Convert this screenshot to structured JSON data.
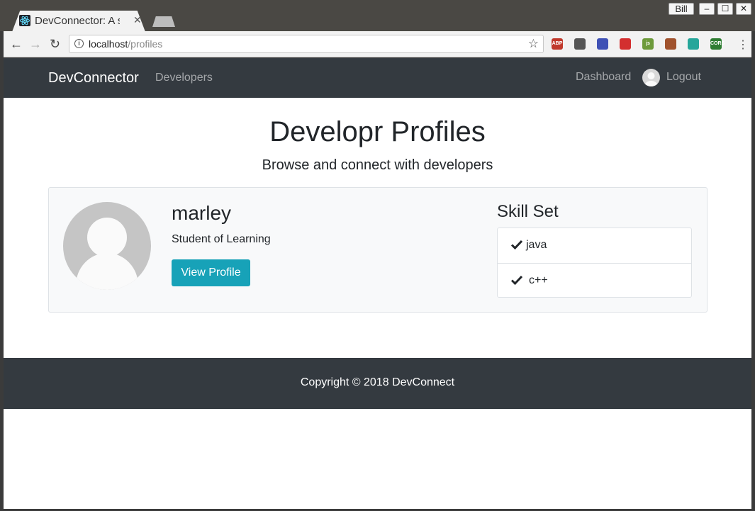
{
  "browser": {
    "tab_title": "DevConnector: A so",
    "url_host": "localhost",
    "url_path": "/profiles",
    "profile_name": "Bill",
    "extensions": [
      {
        "name": "adblock-plus-icon",
        "label": "ABP",
        "color": "#c0392b"
      },
      {
        "name": "sync-icon",
        "label": "",
        "color": "#555555"
      },
      {
        "name": "color-picker-icon",
        "label": "",
        "color": "#3f51b5"
      },
      {
        "name": "extension-red-icon",
        "label": "",
        "color": "#d32f2f"
      },
      {
        "name": "javascript-icon",
        "label": "js",
        "color": "#6d9a3b"
      },
      {
        "name": "monkey-icon",
        "label": "",
        "color": "#a0522d"
      },
      {
        "name": "target-icon",
        "label": "",
        "color": "#26a69a"
      },
      {
        "name": "cors-icon",
        "label": "CORS",
        "color": "#2e7d32"
      }
    ]
  },
  "navbar": {
    "brand": "DevConnector",
    "developers": "Developers",
    "dashboard": "Dashboard",
    "logout": "Logout"
  },
  "header": {
    "title": "Developr Profiles",
    "subtitle": "Browse and connect with developers"
  },
  "profiles": [
    {
      "name": "marley",
      "status": "Student of Learning",
      "button": "View Profile",
      "skills_title": "Skill Set",
      "skills": [
        "java",
        "c++"
      ]
    }
  ],
  "footer": {
    "copyright": "Copyright © 2018 DevConnect"
  },
  "colors": {
    "navbar_bg": "#343a40",
    "button_info": "#17a2b8",
    "card_bg": "#f8f9fa"
  }
}
